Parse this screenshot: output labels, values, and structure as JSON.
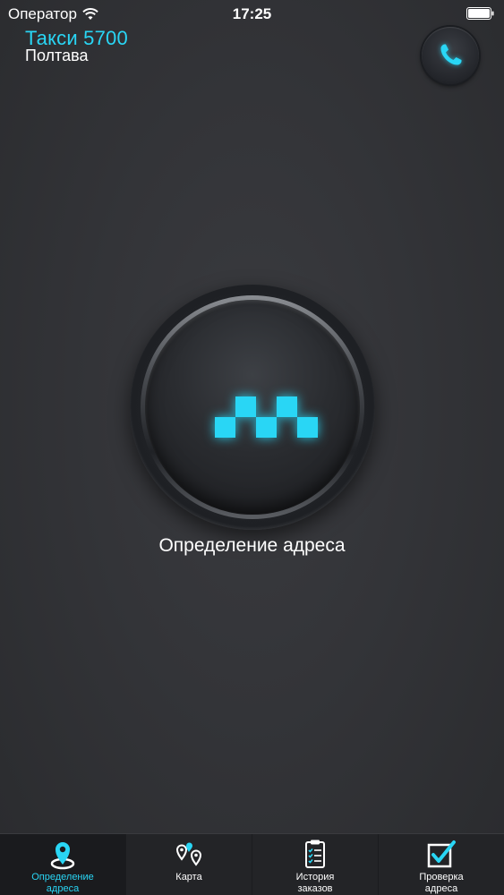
{
  "status_bar": {
    "carrier": "Оператор",
    "time": "17:25"
  },
  "header": {
    "title": "Такси 5700",
    "city": "Полтава"
  },
  "main": {
    "button_label": "Определение адреса"
  },
  "tabs": [
    {
      "label": "Определение\nадреса",
      "icon": "location-pin-icon",
      "active": true
    },
    {
      "label": "Карта",
      "icon": "map-pins-icon",
      "active": false
    },
    {
      "label": "История\nзаказов",
      "icon": "clipboard-icon",
      "active": false
    },
    {
      "label": "Проверка\nадреса",
      "icon": "checkbox-icon",
      "active": false
    }
  ],
  "colors": {
    "accent": "#29d6f5",
    "background": "#333438",
    "tab_bar": "#232427"
  }
}
